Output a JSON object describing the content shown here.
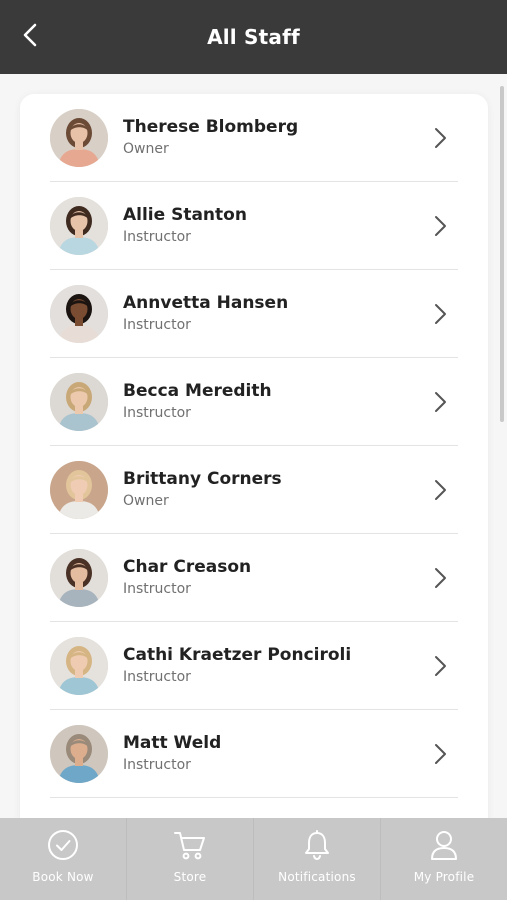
{
  "header": {
    "title": "All Staff",
    "back_icon": "chevron-left-icon"
  },
  "staff": [
    {
      "name": "Therese Blomberg",
      "role": "Owner",
      "bg": "#d8cfc6",
      "hair": "#6b4a36",
      "skin": "#e8c2a8",
      "shirt": "#e6a891"
    },
    {
      "name": "Allie Stanton",
      "role": "Instructor",
      "bg": "#e4e1dd",
      "hair": "#3f2a20",
      "skin": "#e6c2a9",
      "shirt": "#b9d7e0"
    },
    {
      "name": "Annvetta Hansen",
      "role": "Instructor",
      "bg": "#e2dfdc",
      "hair": "#1b1411",
      "skin": "#7a4c32",
      "shirt": "#e8ddd6"
    },
    {
      "name": "Becca Meredith",
      "role": "Instructor",
      "bg": "#dcd8d3",
      "hair": "#c9a878",
      "skin": "#ecc9ad",
      "shirt": "#a9c3cf"
    },
    {
      "name": "Brittany Corners",
      "role": "Owner",
      "bg": "#c9a68b",
      "hair": "#e2c59a",
      "skin": "#efccb3",
      "shirt": "#eceae7"
    },
    {
      "name": "Char Creason",
      "role": "Instructor",
      "bg": "#e2dfdb",
      "hair": "#4a3125",
      "skin": "#e4bc9f",
      "shirt": "#a8b4bd"
    },
    {
      "name": "Cathi Kraetzer Ponciroli",
      "role": "Instructor",
      "bg": "#e5e2de",
      "hair": "#d6b584",
      "skin": "#efccb1",
      "shirt": "#9fc6d4"
    },
    {
      "name": "Matt Weld",
      "role": "Instructor",
      "bg": "#cfc7bd",
      "hair": "#9a8a7a",
      "skin": "#dcae8e",
      "shirt": "#6fa7c9"
    }
  ],
  "row_icon": "chevron-right-icon",
  "bottom_nav": [
    {
      "label": "Book Now",
      "icon": "check-circle-icon"
    },
    {
      "label": "Store",
      "icon": "cart-icon"
    },
    {
      "label": "Notifications",
      "icon": "bell-icon"
    },
    {
      "label": "My Profile",
      "icon": "user-icon"
    }
  ],
  "colors": {
    "header": "#3a3a3a",
    "nav": "#c8c8c8",
    "name": "#222222",
    "role": "#707070"
  }
}
